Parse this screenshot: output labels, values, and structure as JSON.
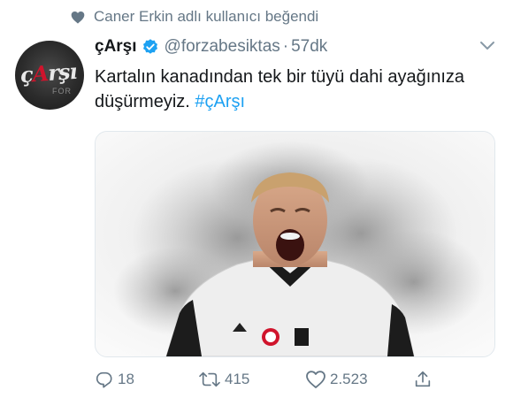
{
  "social_context": {
    "text": "Caner Erkin adlı kullanıcı beğendi",
    "icon": "heart-icon"
  },
  "tweet": {
    "display_name": "çArşı",
    "handle": "@forzabesiktas",
    "separator": "·",
    "time": "57dk",
    "verified": true,
    "text_plain": "Kartalın kanadından tek bir tüyü dahi ayağınıza düşürmeyiz.",
    "hashtag": "#çArşı",
    "avatar_text": "çArşı",
    "media_alt": "Beşiktaş player celebrating in white kit"
  },
  "actions": {
    "replies": "18",
    "retweets": "415",
    "likes": "2.523"
  },
  "colors": {
    "text": "#14171a",
    "muted": "#657786",
    "link": "#1da1f2",
    "verified": "#1da1f2",
    "border": "#e1e8ed"
  }
}
